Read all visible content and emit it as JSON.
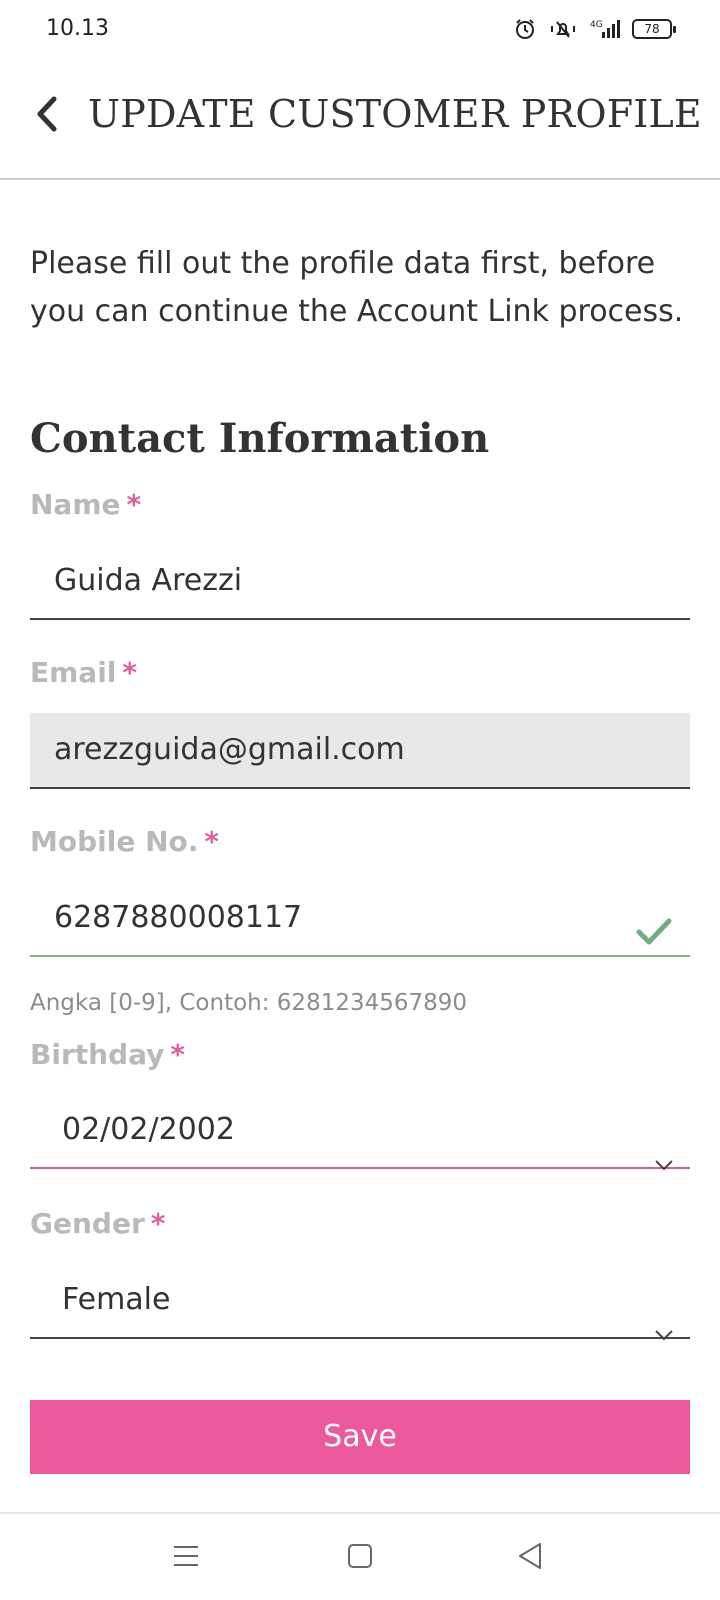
{
  "status_bar": {
    "time": "10.13",
    "battery": "78",
    "network": "4G"
  },
  "header": {
    "title": "UPDATE CUSTOMER PROFILE"
  },
  "intro": "Please fill out the profile data first, before you can continue the Account Link process.",
  "section_title": "Contact Information",
  "form": {
    "required_mark": "*",
    "name": {
      "label": "Name",
      "value": "Guida Arezzi"
    },
    "email": {
      "label": "Email",
      "value": "arezzguida@gmail.com"
    },
    "mobile": {
      "label": "Mobile No.",
      "value": "6287880008117",
      "hint": "Angka [0-9], Contoh: 6281234567890"
    },
    "birthday": {
      "label": "Birthday",
      "value": "02/02/2002"
    },
    "gender": {
      "label": "Gender",
      "value": "Female"
    }
  },
  "save_label": "Save",
  "colors": {
    "accent": "#eb5a9b",
    "required": "#e0609c",
    "valid": "#7ab38a",
    "label": "#b9b9b9"
  },
  "icons": {
    "back": "chevron-left-icon",
    "valid": "check-icon",
    "dropdown": "chevron-down-icon",
    "nav_menu": "menu-icon",
    "nav_home": "square-home-icon",
    "nav_back": "triangle-back-icon"
  }
}
